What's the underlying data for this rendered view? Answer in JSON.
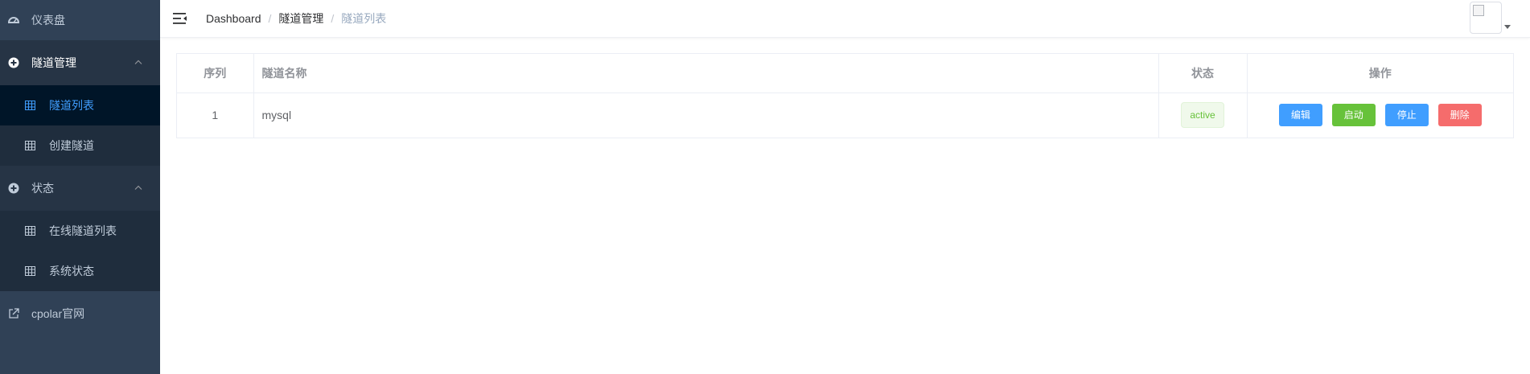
{
  "sidebar": {
    "dashboard": "仪表盘",
    "tunnel_group": "隧道管理",
    "tunnel_list": "隧道列表",
    "create_tunnel": "创建隧道",
    "status_group": "状态",
    "online_tunnels": "在线隧道列表",
    "system_status": "系统状态",
    "official_site": "cpolar官网"
  },
  "breadcrumb": [
    "Dashboard",
    "隧道管理",
    "隧道列表"
  ],
  "breadcrumb_separator": "/",
  "table": {
    "headers": [
      "序列",
      "隧道名称",
      "状态",
      "操作"
    ],
    "rows": [
      {
        "index": "1",
        "name": "mysql",
        "status": "active"
      }
    ]
  },
  "actions": {
    "edit": "编辑",
    "start": "启动",
    "stop": "停止",
    "delete": "删除"
  },
  "colors": {
    "sidebar_bg": "#304156",
    "active_text": "#409eff",
    "success": "#67c23a",
    "danger": "#f56c6c"
  }
}
